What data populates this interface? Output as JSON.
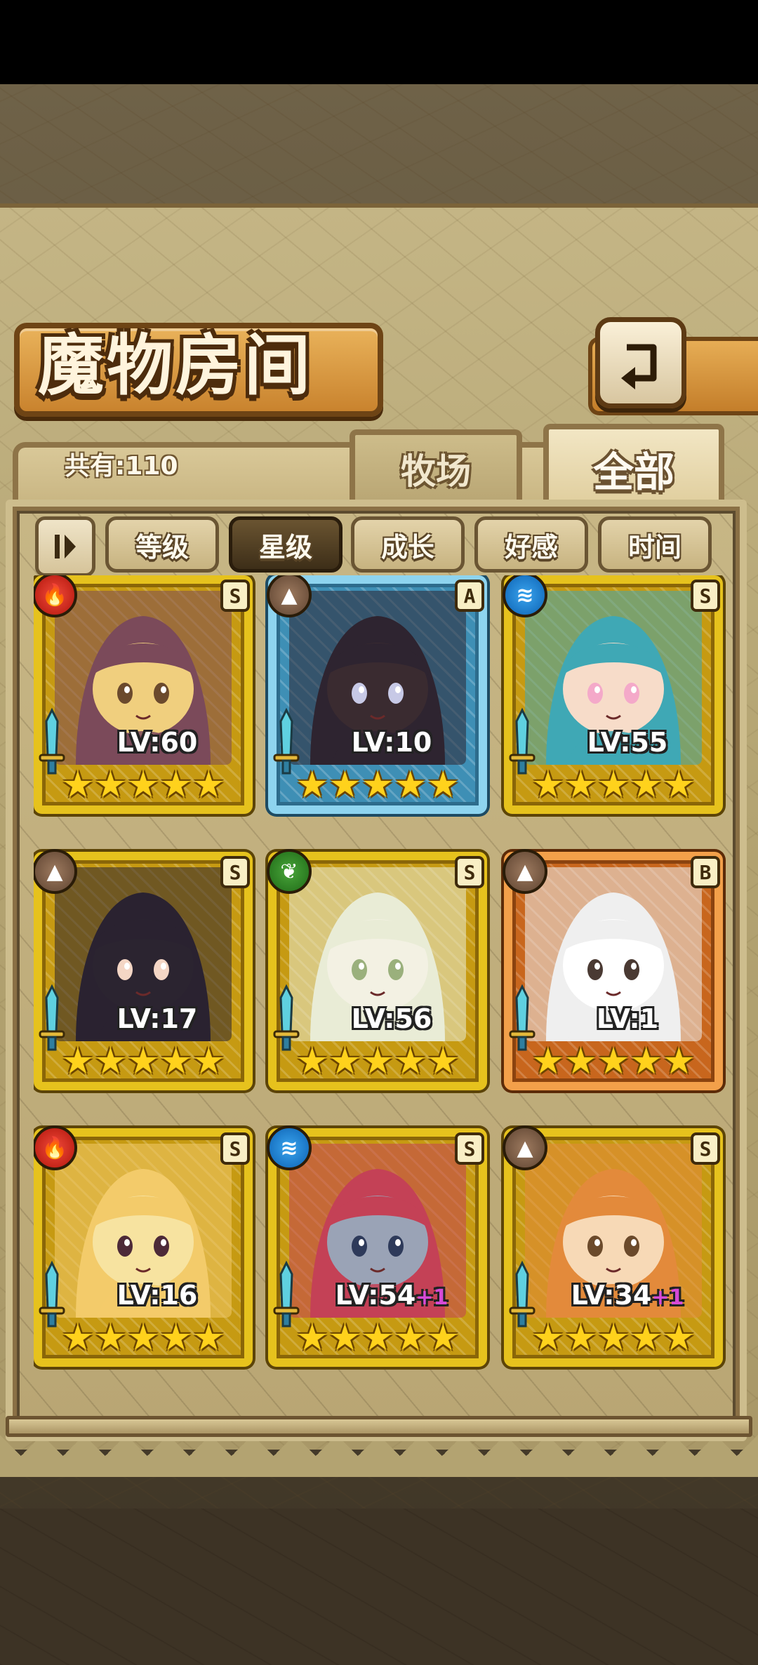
{
  "header": {
    "title": "魔物房间",
    "back_icon": "return-arrow-icon"
  },
  "count": {
    "label": "共有:110"
  },
  "tabs": [
    {
      "label": "牧场",
      "active": false
    },
    {
      "label": "全部",
      "active": true
    }
  ],
  "sort": {
    "toggle_icon": "sort-order-icon",
    "buttons": [
      {
        "label": "等级",
        "active": false
      },
      {
        "label": "星级",
        "active": true
      },
      {
        "label": "成长",
        "active": false
      },
      {
        "label": "好感",
        "active": false
      },
      {
        "label": "时间",
        "active": false
      }
    ]
  },
  "monsters": [
    {
      "element": "fire",
      "grade": "S",
      "level": "LV:60",
      "bonus": "",
      "stars": 5,
      "frame": "gold"
    },
    {
      "element": "earth",
      "grade": "A",
      "level": "LV:10",
      "bonus": "",
      "stars": 5,
      "frame": "blue"
    },
    {
      "element": "water",
      "grade": "S",
      "level": "LV:55",
      "bonus": "",
      "stars": 5,
      "frame": "gold"
    },
    {
      "element": "earth",
      "grade": "S",
      "level": "LV:17",
      "bonus": "",
      "stars": 5,
      "frame": "gold"
    },
    {
      "element": "wood",
      "grade": "S",
      "level": "LV:56",
      "bonus": "",
      "stars": 5,
      "frame": "gold"
    },
    {
      "element": "earth",
      "grade": "B",
      "level": "LV:1",
      "bonus": "",
      "stars": 5,
      "frame": "orange"
    },
    {
      "element": "fire",
      "grade": "S",
      "level": "LV:16",
      "bonus": "",
      "stars": 5,
      "frame": "gold"
    },
    {
      "element": "water",
      "grade": "S",
      "level": "LV:54",
      "bonus": "+1",
      "stars": 5,
      "frame": "gold"
    },
    {
      "element": "earth",
      "grade": "S",
      "level": "LV:34",
      "bonus": "+1",
      "stars": 5,
      "frame": "gold"
    }
  ],
  "colors": {
    "frame_gold": "#e6c21d",
    "frame_blue": "#8ed4ef",
    "frame_orange": "#f3a04a",
    "fire": "#d62418",
    "earth": "#7a5a44",
    "water": "#1c7fd0",
    "wood": "#2f8a25",
    "bonus": "#d64ad6"
  }
}
